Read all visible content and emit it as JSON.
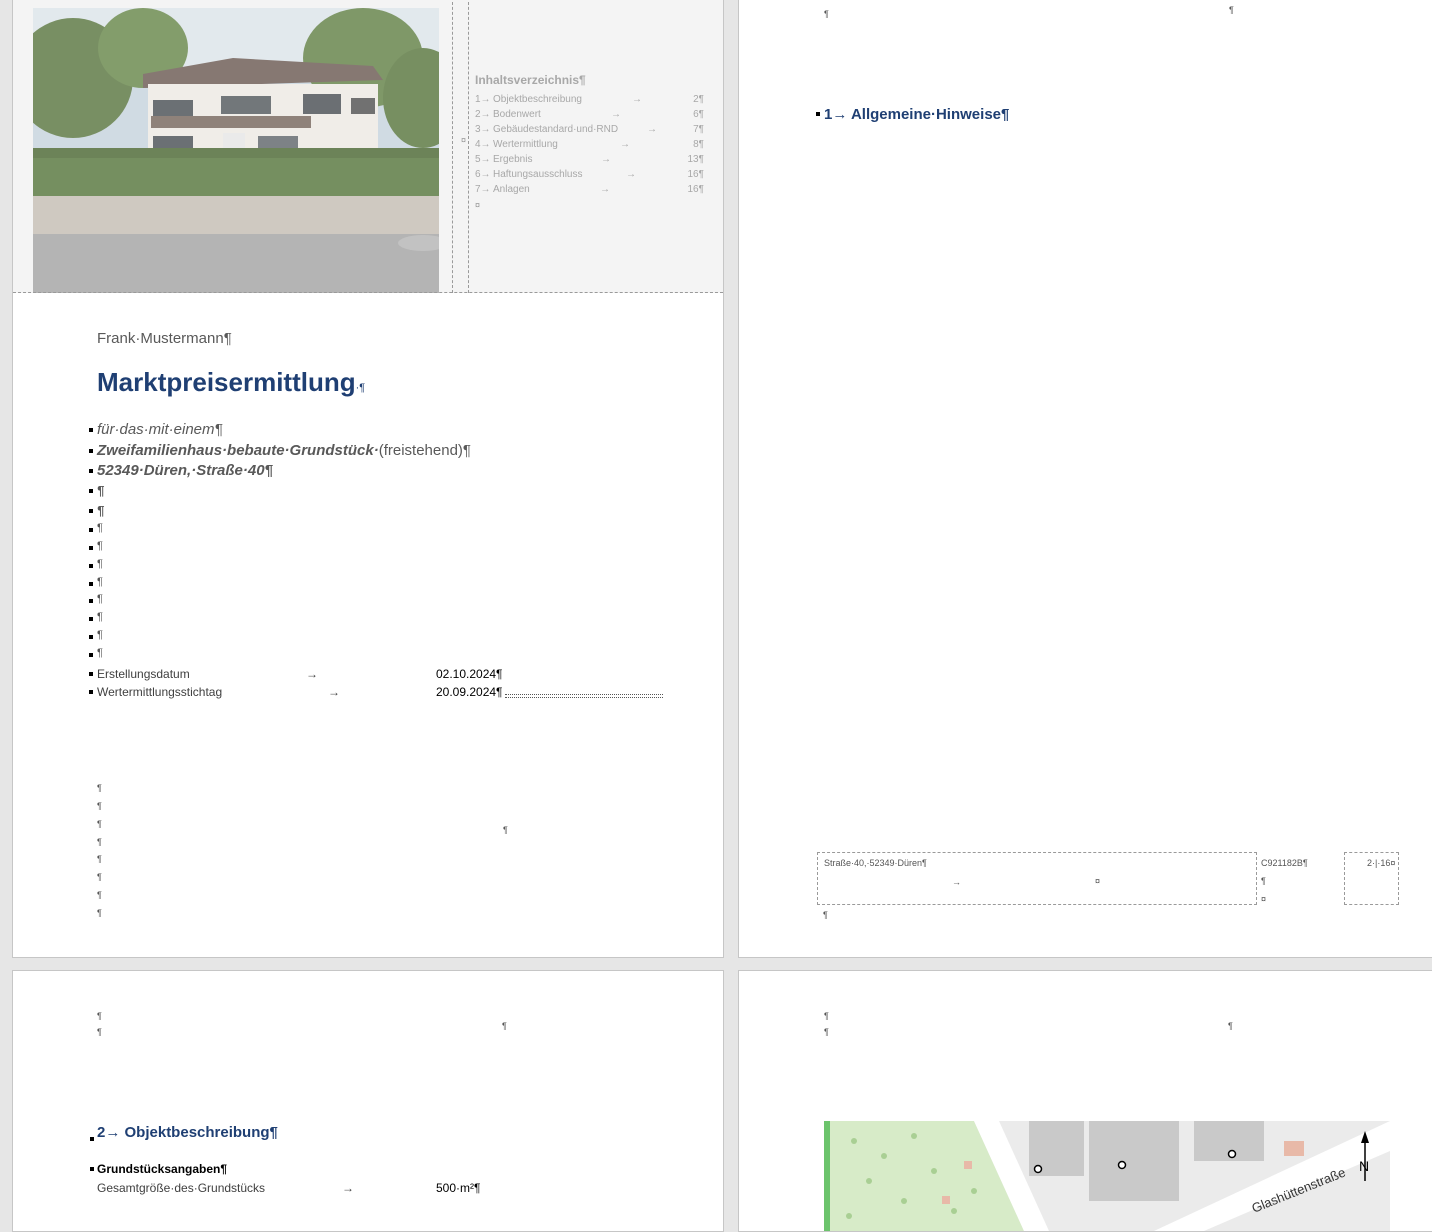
{
  "cover": {
    "author": "Frank·Mustermann¶",
    "title": "Marktpreisermittlung",
    "title_mark": "·¶",
    "subtitle_lines": [
      "für·das·mit·einem¶",
      "Zweifamilienhaus·bebaute·Grundstück·",
      "52349·Düren,·Straße·40¶"
    ],
    "subtitle_suffix": "(freistehend)¶",
    "creation_label": "Erstellungsdatum",
    "creation_date": "02.10.2024¶",
    "valuation_label": "Wertermittlungsstichtag",
    "valuation_date": "20.09.2024¶"
  },
  "toc": {
    "title": "Inhaltsverzeichnis¶",
    "items": [
      {
        "num": "1→",
        "label": "Objektbeschreibung",
        "page": "2¶"
      },
      {
        "num": "2→",
        "label": "Bodenwert",
        "page": "6¶"
      },
      {
        "num": "3→",
        "label": "Gebäudestandard·und·RND",
        "page": "7¶"
      },
      {
        "num": "4→",
        "label": "Wertermittlung",
        "page": "8¶"
      },
      {
        "num": "5→",
        "label": "Ergebnis",
        "page": "13¶"
      },
      {
        "num": "6→",
        "label": "Haftungsausschluss",
        "page": "16¶"
      },
      {
        "num": "7→",
        "label": "Anlagen",
        "page": "16¶"
      }
    ],
    "end_mark": "¤"
  },
  "page2": {
    "heading": "1→ Allgemeine·Hinweise¶",
    "footer_address": "Straße·40,·52349·Düren¶",
    "footer_code": "C921182B¶",
    "footer_page": "2·|·16¤"
  },
  "page3": {
    "heading": "2→ Objektbeschreibung¶",
    "section": "Grundstücksangaben¶",
    "row_label": "Gesamtgröße·des·Grundstücks",
    "row_value": "500·m²¶"
  },
  "page4": {
    "map_street": "Glashüttenstraße",
    "map_north": "N"
  },
  "marks": {
    "pilcrow": "¶",
    "tab": "→",
    "cell_end": "¤"
  }
}
